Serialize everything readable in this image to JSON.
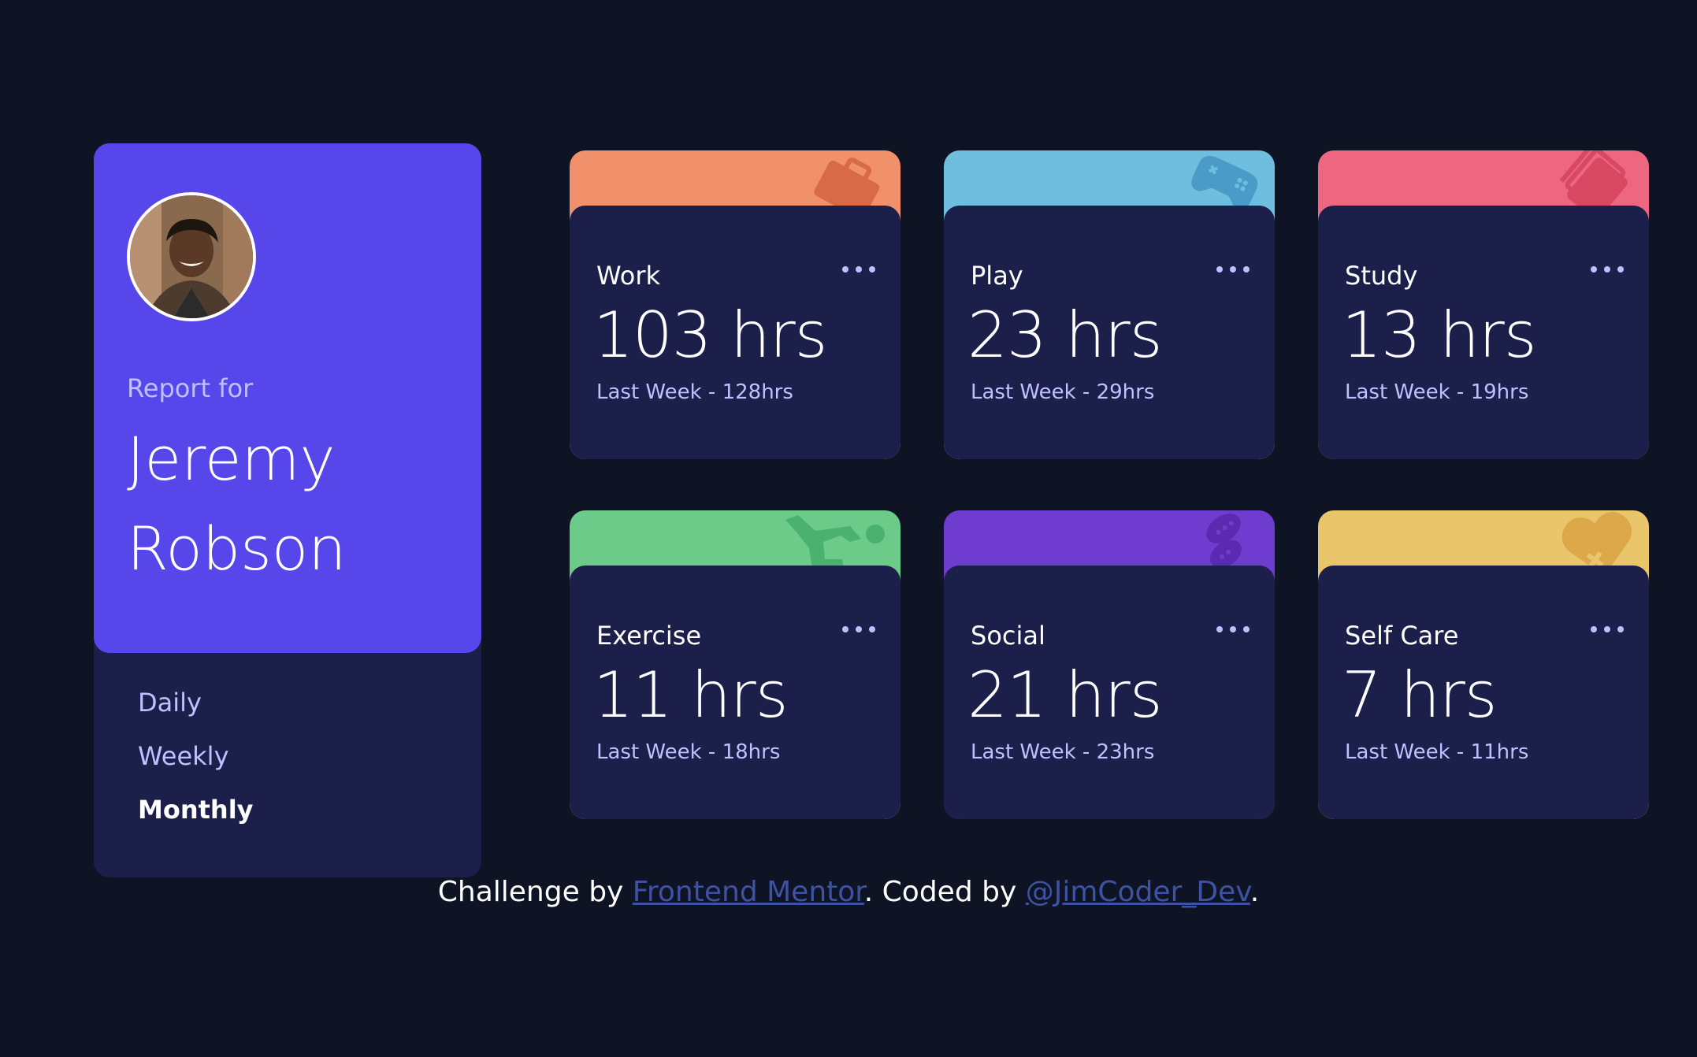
{
  "profile": {
    "report_for": "Report for",
    "name": "Jeremy Robson",
    "avatar": "avatar-photo"
  },
  "periods": [
    {
      "label": "Daily",
      "active": false
    },
    {
      "label": "Weekly",
      "active": false
    },
    {
      "label": "Monthly",
      "active": true
    }
  ],
  "cards": [
    {
      "title": "Work",
      "hours": "103 hrs",
      "previous": "Last Week - 128hrs",
      "color": "#f1916c",
      "icon": "briefcase-icon"
    },
    {
      "title": "Play",
      "hours": "23 hrs",
      "previous": "Last Week - 29hrs",
      "color": "#6fbedf",
      "icon": "gamepad-icon"
    },
    {
      "title": "Study",
      "hours": "13 hrs",
      "previous": "Last Week - 19hrs",
      "color": "#ed6780",
      "icon": "books-icon"
    },
    {
      "title": "Exercise",
      "hours": "11 hrs",
      "previous": "Last Week - 18hrs",
      "color": "#6ccb89",
      "icon": "running-icon"
    },
    {
      "title": "Social",
      "hours": "21 hrs",
      "previous": "Last Week - 23hrs",
      "color": "#6e3ccf",
      "icon": "chat-icon"
    },
    {
      "title": "Self Care",
      "hours": "7 hrs",
      "previous": "Last Week - 11hrs",
      "color": "#e9c56c",
      "icon": "heart-icon"
    }
  ],
  "footer": {
    "prefix": "Challenge by ",
    "link1": "Frontend Mentor",
    "middle": ". Coded by ",
    "link2": "@JimCoder_Dev",
    "suffix": "."
  }
}
